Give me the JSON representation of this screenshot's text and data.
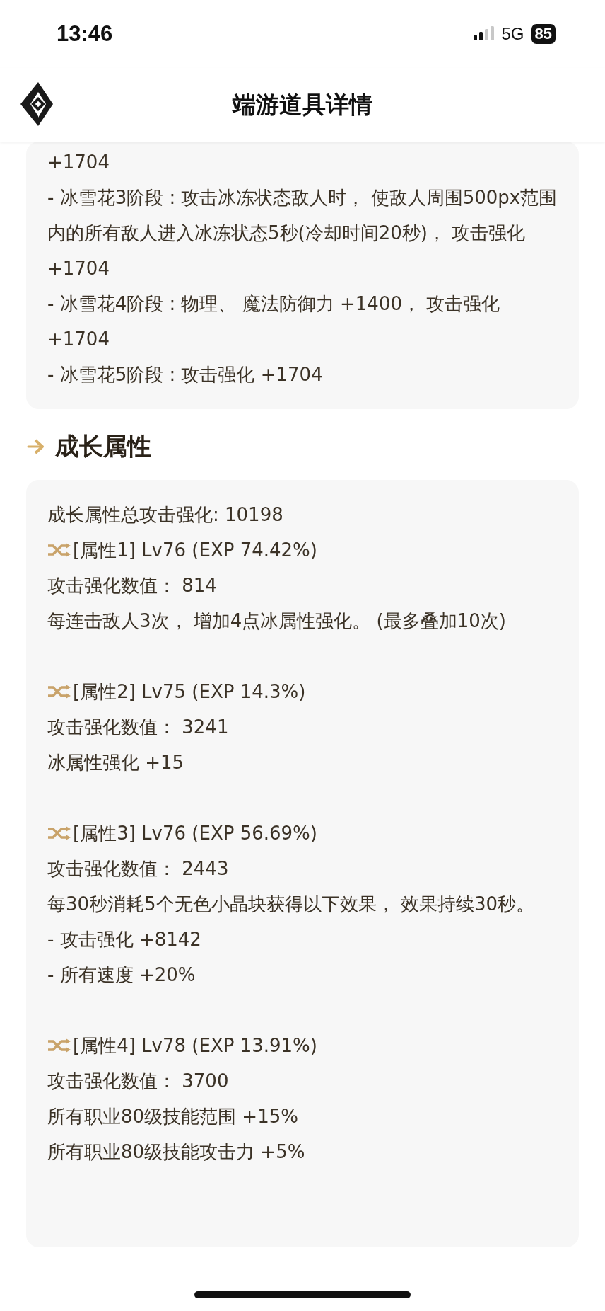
{
  "status_bar": {
    "time": "13:46",
    "network": "5G",
    "battery": "85"
  },
  "header": {
    "title": "端游道具详情"
  },
  "effects_card": {
    "lines": [
      "+1704",
      "- 冰雪花3阶段 : 攻击冰冻状态敌人时， 使敌人周围500px范围内的所有敌人进入冰冻状态5秒(冷却时间20秒)， 攻击强化 +1704",
      "- 冰雪花4阶段 : 物理、 魔法防御力 +1400， 攻击强化 +1704",
      "- 冰雪花5阶段 : 攻击强化 +1704"
    ]
  },
  "growth_section": {
    "title": "成长属性",
    "total": "成长属性总攻击强化: 10198",
    "attributes": [
      {
        "header": "[属性1] Lv76 (EXP 74.42%)",
        "lines": [
          "攻击强化数值： 814",
          "每连击敌人3次， 增加4点冰属性强化。 (最多叠加10次)"
        ]
      },
      {
        "header": "[属性2] Lv75 (EXP 14.3%)",
        "lines": [
          "攻击强化数值： 3241",
          "冰属性强化 +15"
        ]
      },
      {
        "header": "[属性3] Lv76 (EXP 56.69%)",
        "lines": [
          "攻击强化数值： 2443",
          "每30秒消耗5个无色小晶块获得以下效果， 效果持续30秒。",
          "- 攻击强化 +8142",
          "- 所有速度 +20%"
        ]
      },
      {
        "header": "[属性4] Lv78 (EXP 13.91%)",
        "lines": [
          "攻击强化数值： 3700",
          "所有职业80级技能范围 +15%",
          "所有职业80级技能攻击力 +5%"
        ]
      }
    ]
  }
}
